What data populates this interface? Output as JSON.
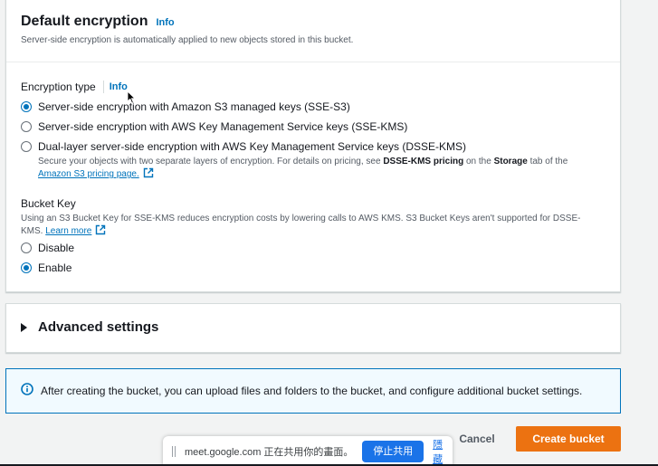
{
  "encryption_panel": {
    "title": "Default encryption",
    "info": "Info",
    "description": "Server-side encryption is automatically applied to new objects stored in this bucket.",
    "encryption_type": {
      "label": "Encryption type",
      "info": "Info",
      "options": [
        {
          "label": "Server-side encryption with Amazon S3 managed keys (SSE-S3)",
          "selected": true
        },
        {
          "label": "Server-side encryption with AWS Key Management Service keys (SSE-KMS)",
          "selected": false
        },
        {
          "label": "Dual-layer server-side encryption with AWS Key Management Service keys (DSSE-KMS)",
          "selected": false
        }
      ],
      "dsse_desc_prefix": "Secure your objects with two separate layers of encryption. For details on pricing, see ",
      "dsse_desc_bold1": "DSSE-KMS pricing",
      "dsse_desc_mid": " on the ",
      "dsse_desc_bold2": "Storage",
      "dsse_desc_suffix": " tab of the",
      "dsse_link": "Amazon S3 pricing page."
    },
    "bucket_key": {
      "label": "Bucket Key",
      "description": "Using an S3 Bucket Key for SSE-KMS reduces encryption costs by lowering calls to AWS KMS. S3 Bucket Keys aren't supported for DSSE-KMS.",
      "learn_more": "Learn more",
      "options": [
        {
          "label": "Disable",
          "selected": false
        },
        {
          "label": "Enable",
          "selected": true
        }
      ]
    }
  },
  "advanced_settings": {
    "title": "Advanced settings"
  },
  "alert": {
    "text": "After creating the bucket, you can upload files and folders to the bucket, and configure additional bucket settings."
  },
  "actions": {
    "cancel": "Cancel",
    "create": "Create bucket"
  },
  "share_bar": {
    "text": "meet.google.com 正在共用你的畫面。",
    "stop": "停止共用",
    "hide": "隱藏"
  },
  "colors": {
    "primary_button": "#ec7211",
    "link": "#0073bb",
    "alert_bg": "#f1faff",
    "meet_blue": "#1a73e8"
  },
  "icons": [
    "info-circle-icon",
    "external-link-icon",
    "caret-right-icon",
    "drag-handle-icon",
    "mouse-cursor-icon"
  ]
}
